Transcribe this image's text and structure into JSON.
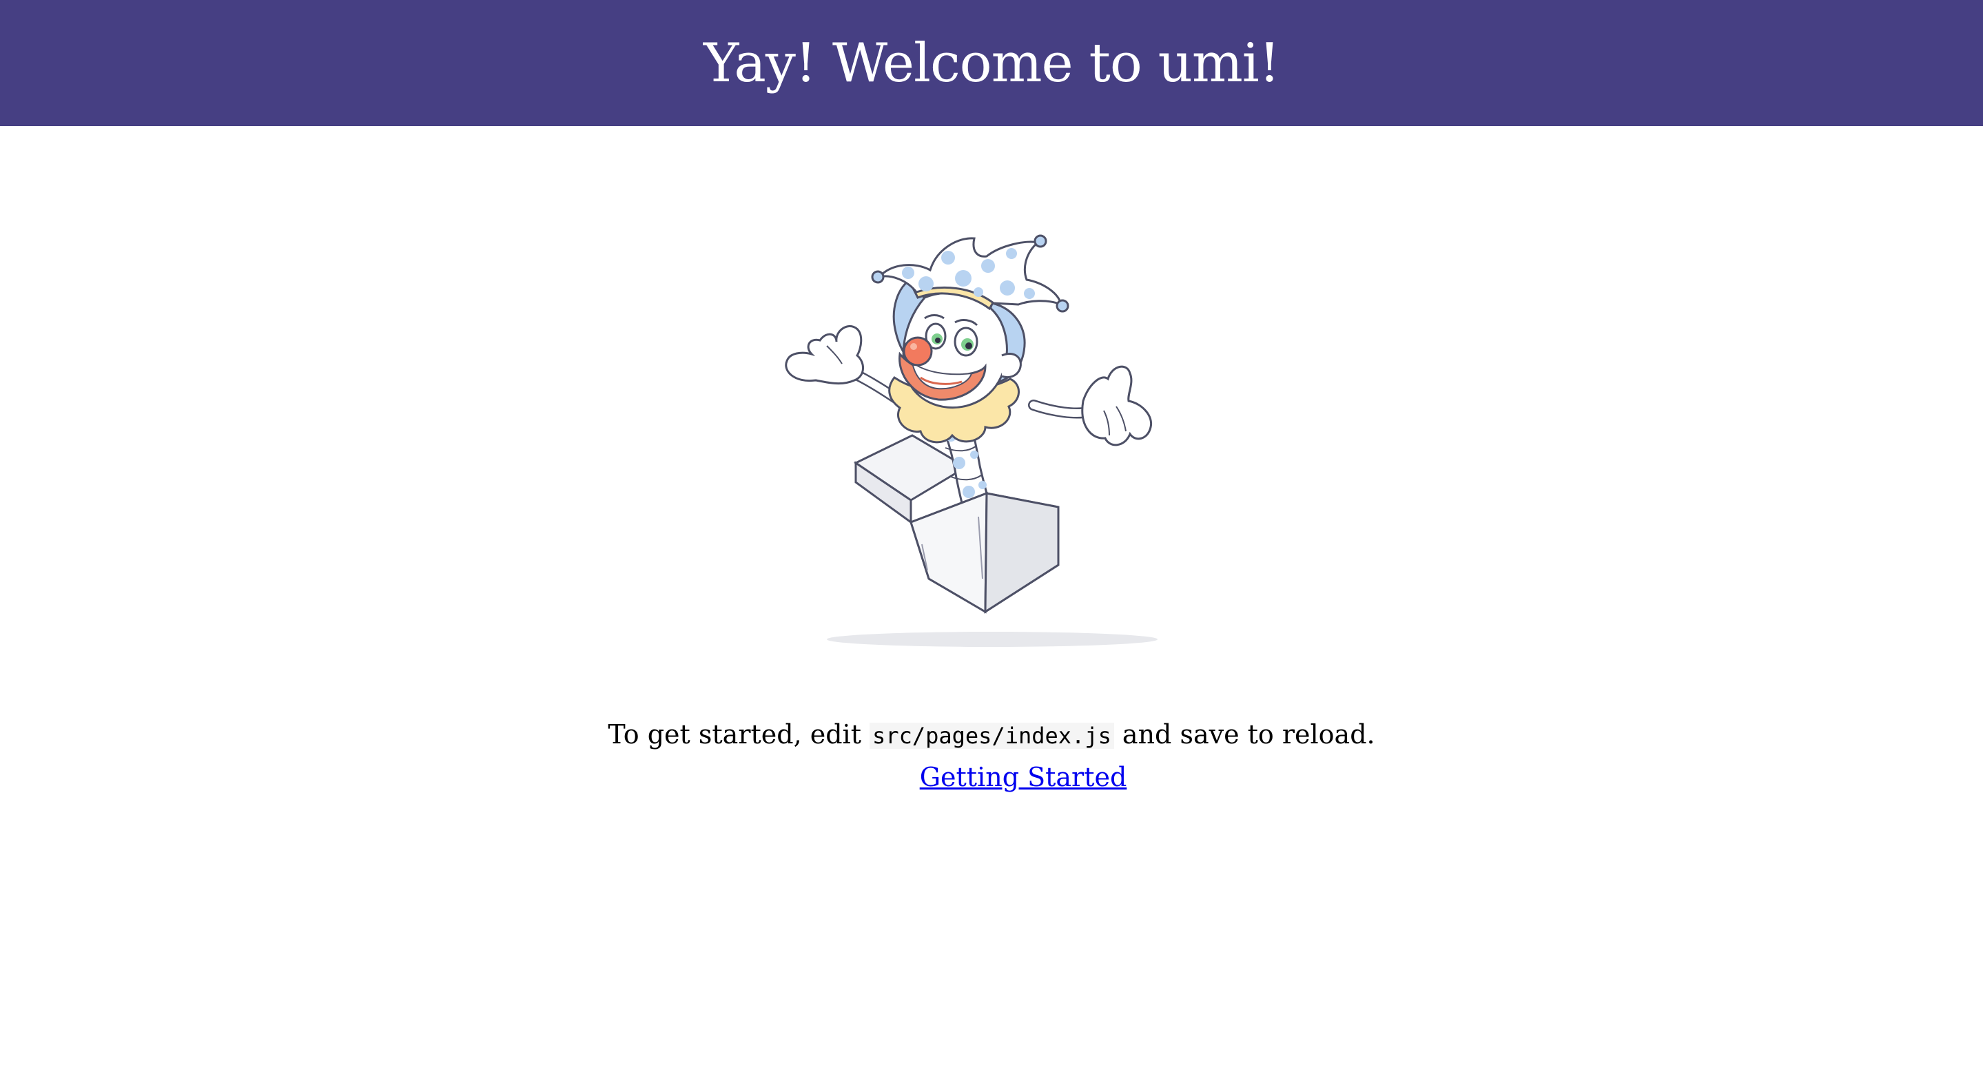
{
  "header": {
    "title": "Yay! Welcome to umi!",
    "background_color": "#463f83"
  },
  "illustration": {
    "icon": "jester-in-box-illustration"
  },
  "intro": {
    "text_before": "To get started, edit ",
    "code_path": "src/pages/index.js",
    "text_after": " and save to reload."
  },
  "link": {
    "label": "Getting Started"
  }
}
